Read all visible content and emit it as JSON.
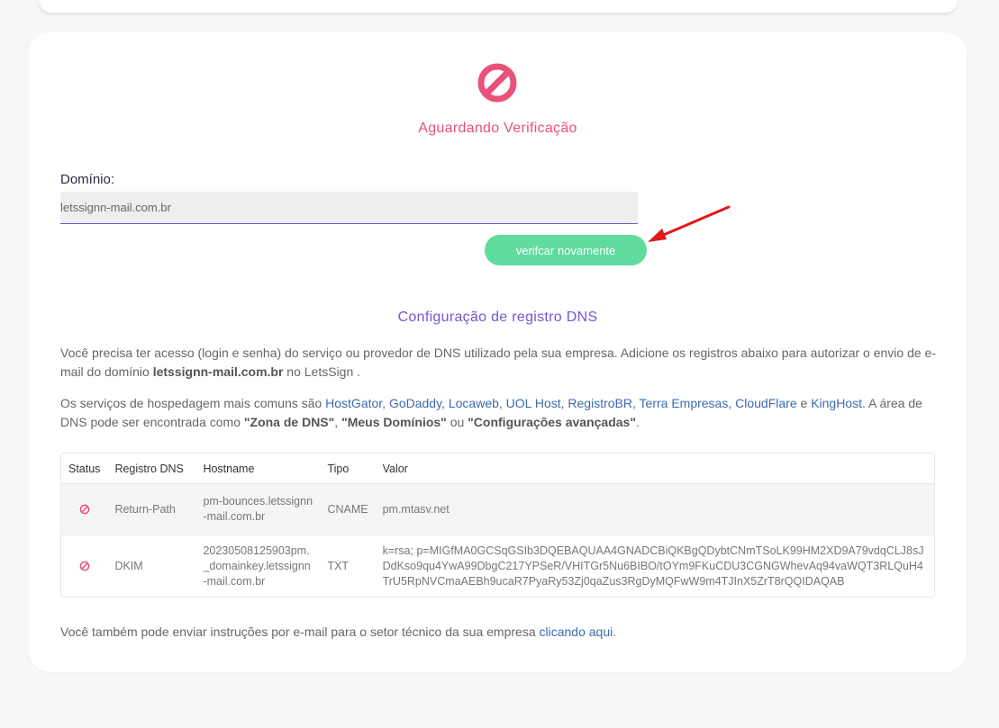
{
  "colors": {
    "status_pink": "#e9517a",
    "dns_title_purple": "#7356d6",
    "button_green": "#5fdc9d",
    "link_blue": "#3d6ab0",
    "arrow_red": "#e0191a"
  },
  "status": {
    "icon": "ban-icon",
    "title": "Aguardando Verificação"
  },
  "domain": {
    "label": "Domínio:",
    "value": "letssignn-mail.com.br"
  },
  "verify_button_label": "verifcar novamente",
  "dns_section": {
    "title": "Configuração de registro DNS",
    "para1_text": "Você precisa ter acesso (login e senha) do serviço ou provedor de DNS utilizado pela sua empresa. Adicione os registros abaixo para autorizar o envio de e-mail do domínio ",
    "para1_domain": "letssignn-mail.com.br",
    "para1_suffix": " no LetsSign .",
    "para2_prefix": "Os serviços de hospedagem mais comuns são ",
    "hosting_links": [
      "HostGator",
      "GoDaddy",
      "Locaweb",
      "UOL Host",
      "RegistroBR",
      "Terra Empresas",
      "CloudFlare",
      "KingHost"
    ],
    "sep_comma": ", ",
    "sep_and": " e ",
    "para2_middle": ". A área de DNS pode ser encontrada como ",
    "zone1": "\"Zona de DNS\"",
    "comma": ", ",
    "zone2": "\"Meus Domínios\"",
    "or_word": " ou ",
    "zone3": "\"Configurações avançadas\"",
    "period": "."
  },
  "table": {
    "headers": [
      "Status",
      "Registro DNS",
      "Hostname",
      "Tipo",
      "Valor"
    ],
    "rows": [
      {
        "status_icon": "ban-icon",
        "registro": "Return-Path",
        "hostname": "pm-bounces.letssignn-mail.com.br",
        "tipo": "CNAME",
        "valor": "pm.mtasv.net"
      },
      {
        "status_icon": "ban-icon",
        "registro": "DKIM",
        "hostname": "20230508125903pm._domainkey.letssignn-mail.com.br",
        "tipo": "TXT",
        "valor": "k=rsa; p=MIGfMA0GCSqGSIb3DQEBAQUAA4GNADCBiQKBgQDybtCNmTSoLK99HM2XD9A79vdqCLJ8sJDdKso9qu4YwA99DbgC217YPSeR/VHITGr5Nu6BIBO/tOYm9FKuCDU3CGNGWhevAq94vaWQT3RLQuH4TrU5RpNVCmaAEBh9ucaR7PyaRy53Zj0qaZus3RgDyMQFwW9m4TJInX5ZrT8rQQIDAQAB"
      }
    ]
  },
  "footer": {
    "text": "Você também pode enviar instruções por e-mail para o setor técnico da sua empresa ",
    "link": "clicando aqui",
    "end": "."
  }
}
